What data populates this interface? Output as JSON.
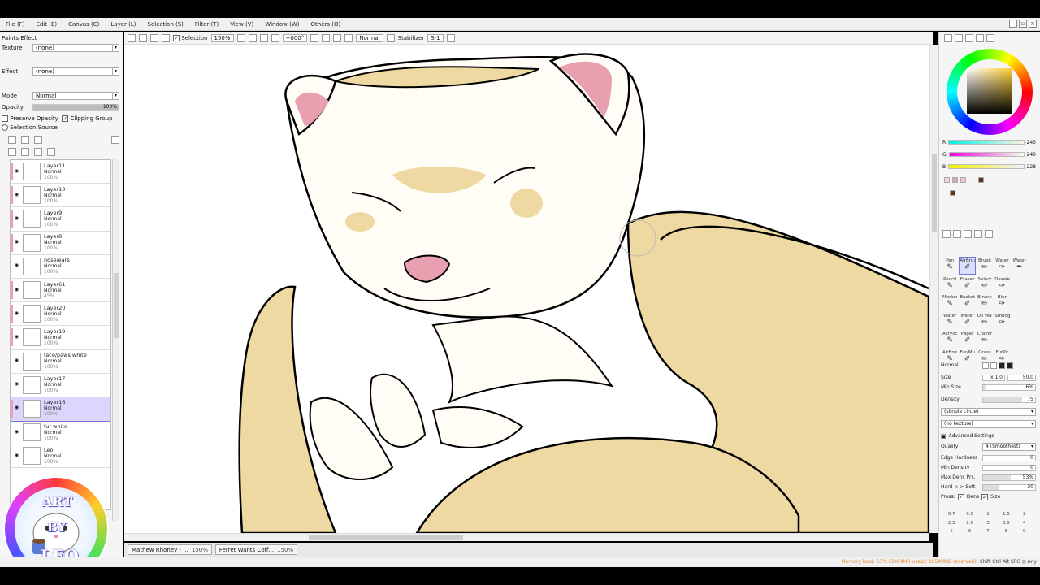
{
  "menu": [
    "File (F)",
    "Edit (E)",
    "Canvas (C)",
    "Layer (L)",
    "Selection (S)",
    "Filter (T)",
    "View (V)",
    "Window (W)",
    "Others (O)"
  ],
  "toolbar": {
    "selection_label": "Selection",
    "zoom": "150%",
    "rotation": "+000°",
    "mode": "Normal",
    "stabilizer_label": "Stabilizer",
    "stabilizer_value": "S-1"
  },
  "left": {
    "paint_effect": "Paints Effect",
    "texture_label": "Texture",
    "texture_value": "(none)",
    "effect_label": "Effect",
    "effect_value": "(none)",
    "mode_label": "Mode",
    "mode_value": "Normal",
    "opacity_label": "Opacity",
    "opacity_value": "100%",
    "opacity_fraction": 1.0,
    "preserve_opacity": "Preserve Opacity",
    "clipping_group": "Clipping Group",
    "selection_source": "Selection Source"
  },
  "layers": [
    {
      "name": "Layer11",
      "mode": "Normal",
      "opacity": "100%",
      "clip": true,
      "selected": false
    },
    {
      "name": "Layer10",
      "mode": "Normal",
      "opacity": "100%",
      "clip": true,
      "selected": false
    },
    {
      "name": "Layer9",
      "mode": "Normal",
      "opacity": "100%",
      "clip": true,
      "selected": false
    },
    {
      "name": "Layer8",
      "mode": "Normal",
      "opacity": "100%",
      "clip": true,
      "selected": false
    },
    {
      "name": "nose/ears",
      "mode": "Normal",
      "opacity": "100%",
      "clip": false,
      "selected": false
    },
    {
      "name": "Layer61",
      "mode": "Normal",
      "opacity": "45%",
      "clip": true,
      "selected": false
    },
    {
      "name": "Layer20",
      "mode": "Normal",
      "opacity": "100%",
      "clip": true,
      "selected": false
    },
    {
      "name": "Layer19",
      "mode": "Normal",
      "opacity": "100%",
      "clip": true,
      "selected": false
    },
    {
      "name": "face/paws white",
      "mode": "Normal",
      "opacity": "100%",
      "clip": false,
      "selected": false
    },
    {
      "name": "Layer17",
      "mode": "Normal",
      "opacity": "100%",
      "clip": false,
      "selected": false
    },
    {
      "name": "Layer16",
      "mode": "Normal",
      "opacity": "100%",
      "clip": true,
      "selected": true
    },
    {
      "name": "fur white",
      "mode": "Normal",
      "opacity": "100%",
      "clip": false,
      "selected": false
    },
    {
      "name": "Leo",
      "mode": "Normal",
      "opacity": "100%",
      "clip": false,
      "selected": false
    }
  ],
  "tabs": [
    {
      "name": "Mathew Rhoney - ...",
      "zoom": "150%",
      "active": true
    },
    {
      "name": "Ferret Wants Coff...",
      "zoom": "150%",
      "active": false
    }
  ],
  "color": {
    "r": 243,
    "g": 240,
    "b": 228,
    "r_label": "R",
    "g_label": "G",
    "b_label": "B",
    "swatches": [
      "#f0cfd6",
      "#d8a8b0",
      "#e8c8c8",
      "#5a3020",
      "#5a3a20"
    ]
  },
  "tools": [
    {
      "name": "Pen",
      "selected": false
    },
    {
      "name": "AirBrush",
      "selected": true
    },
    {
      "name": "Brush",
      "selected": false
    },
    {
      "name": "Water",
      "selected": false
    },
    {
      "name": "Water",
      "selected": false
    },
    {
      "name": "Pencil",
      "selected": false
    },
    {
      "name": "Eraser",
      "selected": false
    },
    {
      "name": "Select",
      "selected": false
    },
    {
      "name": "Deselect",
      "selected": false
    },
    {
      "name": "",
      "selected": false
    },
    {
      "name": "Marker",
      "selected": false
    },
    {
      "name": "Bucket",
      "selected": false
    },
    {
      "name": "Binary",
      "selected": false
    },
    {
      "name": "Blur",
      "selected": false
    },
    {
      "name": "",
      "selected": false
    },
    {
      "name": "Water",
      "selected": false
    },
    {
      "name": "Water",
      "selected": false
    },
    {
      "name": "Oil Water",
      "selected": false
    },
    {
      "name": "Smudge",
      "selected": false
    },
    {
      "name": "",
      "selected": false
    },
    {
      "name": "Acrylic",
      "selected": false
    },
    {
      "name": "Paper",
      "selected": false
    },
    {
      "name": "Crayon",
      "selected": false
    },
    {
      "name": "",
      "selected": false
    },
    {
      "name": "",
      "selected": false
    },
    {
      "name": "AirBrush",
      "selected": false
    },
    {
      "name": "Fur/Mul",
      "selected": false
    },
    {
      "name": "Grass",
      "selected": false
    },
    {
      "name": "FurPit",
      "selected": false
    },
    {
      "name": "",
      "selected": false
    }
  ],
  "brush": {
    "blend": "Normal",
    "size_label": "Size",
    "size_mult": "x 1.0",
    "size_value": "50.0",
    "min_size_label": "Min Size",
    "min_size_value": "6%",
    "density_label": "Density",
    "density_value": "75",
    "shape": "(simple circle)",
    "texture": "(no texture)",
    "advanced": "Advanced Settings",
    "quality_label": "Quality",
    "quality_value": "4 (Smoothest)",
    "edge_label": "Edge Hardness",
    "edge_value": "0",
    "min_density_label": "Min Density",
    "min_density_value": "0",
    "max_dens_label": "Max Dens Prs.",
    "max_dens_value": "53%",
    "hard_soft_label": "Hard <-> Soft",
    "hard_soft_value": "30",
    "press_label": "Press:",
    "press_dens": "Dens",
    "press_size": "Size"
  },
  "sizes": [
    "0.7",
    "0.8",
    "1",
    "1.5",
    "2",
    "2.3",
    "2.6",
    "3",
    "3.5",
    "4",
    "5",
    "6",
    "7",
    "8",
    "9"
  ],
  "status": {
    "memory": "Memory load: 63% (3084MB used / 20549MB reserved)",
    "keys": "Shift Ctrl Alt SPC ◎ Any"
  },
  "logo": {
    "line1": "ART",
    "line2": "BY",
    "line3": "LEO"
  }
}
